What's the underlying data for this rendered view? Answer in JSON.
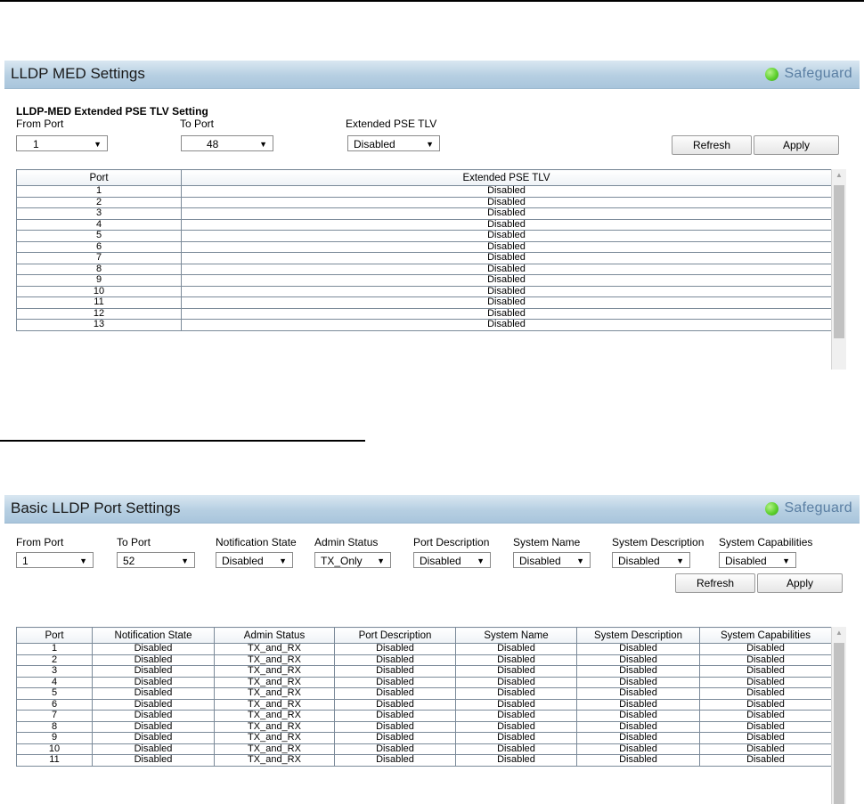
{
  "panel1": {
    "title": "LLDP MED Settings",
    "safeguard": "Safeguard",
    "section_title": "LLDP-MED Extended PSE TLV Setting",
    "from_port_label": "From Port",
    "from_port_value": "1",
    "to_port_label": "To Port",
    "to_port_value": "48",
    "tlv_label": "Extended PSE TLV",
    "tlv_value": "Disabled",
    "refresh": "Refresh",
    "apply": "Apply",
    "columns": [
      "Port",
      "Extended PSE TLV"
    ],
    "rows": [
      [
        "1",
        "Disabled"
      ],
      [
        "2",
        "Disabled"
      ],
      [
        "3",
        "Disabled"
      ],
      [
        "4",
        "Disabled"
      ],
      [
        "5",
        "Disabled"
      ],
      [
        "6",
        "Disabled"
      ],
      [
        "7",
        "Disabled"
      ],
      [
        "8",
        "Disabled"
      ],
      [
        "9",
        "Disabled"
      ],
      [
        "10",
        "Disabled"
      ],
      [
        "11",
        "Disabled"
      ],
      [
        "12",
        "Disabled"
      ],
      [
        "13",
        "Disabled"
      ]
    ]
  },
  "panel2": {
    "title": "Basic LLDP Port Settings",
    "safeguard": "Safeguard",
    "filters": [
      {
        "label": "From Port",
        "value": "1"
      },
      {
        "label": "To Port",
        "value": "52"
      },
      {
        "label": "Notification State",
        "value": "Disabled"
      },
      {
        "label": "Admin Status",
        "value": "TX_Only"
      },
      {
        "label": "Port Description",
        "value": "Disabled"
      },
      {
        "label": "System Name",
        "value": "Disabled"
      },
      {
        "label": "System Description",
        "value": "Disabled"
      },
      {
        "label": "System Capabilities",
        "value": "Disabled"
      }
    ],
    "refresh": "Refresh",
    "apply": "Apply",
    "columns": [
      "Port",
      "Notification State",
      "Admin Status",
      "Port Description",
      "System Name",
      "System Description",
      "System Capabilities"
    ],
    "rows": [
      [
        "1",
        "Disabled",
        "TX_and_RX",
        "Disabled",
        "Disabled",
        "Disabled",
        "Disabled"
      ],
      [
        "2",
        "Disabled",
        "TX_and_RX",
        "Disabled",
        "Disabled",
        "Disabled",
        "Disabled"
      ],
      [
        "3",
        "Disabled",
        "TX_and_RX",
        "Disabled",
        "Disabled",
        "Disabled",
        "Disabled"
      ],
      [
        "4",
        "Disabled",
        "TX_and_RX",
        "Disabled",
        "Disabled",
        "Disabled",
        "Disabled"
      ],
      [
        "5",
        "Disabled",
        "TX_and_RX",
        "Disabled",
        "Disabled",
        "Disabled",
        "Disabled"
      ],
      [
        "6",
        "Disabled",
        "TX_and_RX",
        "Disabled",
        "Disabled",
        "Disabled",
        "Disabled"
      ],
      [
        "7",
        "Disabled",
        "TX_and_RX",
        "Disabled",
        "Disabled",
        "Disabled",
        "Disabled"
      ],
      [
        "8",
        "Disabled",
        "TX_and_RX",
        "Disabled",
        "Disabled",
        "Disabled",
        "Disabled"
      ],
      [
        "9",
        "Disabled",
        "TX_and_RX",
        "Disabled",
        "Disabled",
        "Disabled",
        "Disabled"
      ],
      [
        "10",
        "Disabled",
        "TX_and_RX",
        "Disabled",
        "Disabled",
        "Disabled",
        "Disabled"
      ],
      [
        "11",
        "Disabled",
        "TX_and_RX",
        "Disabled",
        "Disabled",
        "Disabled",
        "Disabled"
      ]
    ]
  }
}
